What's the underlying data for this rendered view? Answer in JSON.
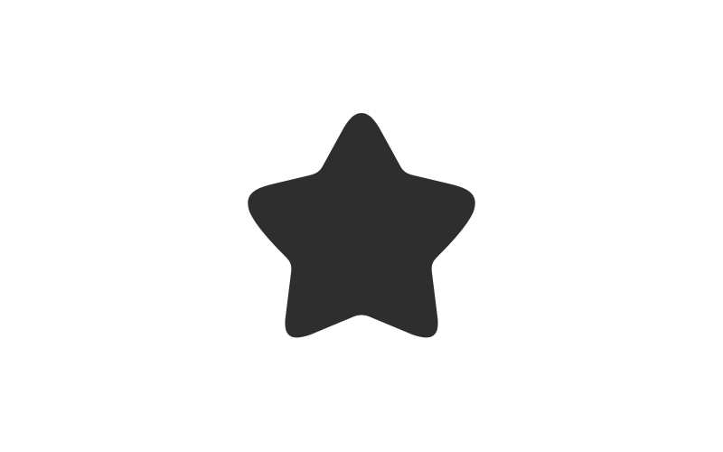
{
  "icon": {
    "name": "star-icon",
    "color": "#2e2e2e"
  },
  "background": {
    "color": "#ffffff"
  }
}
